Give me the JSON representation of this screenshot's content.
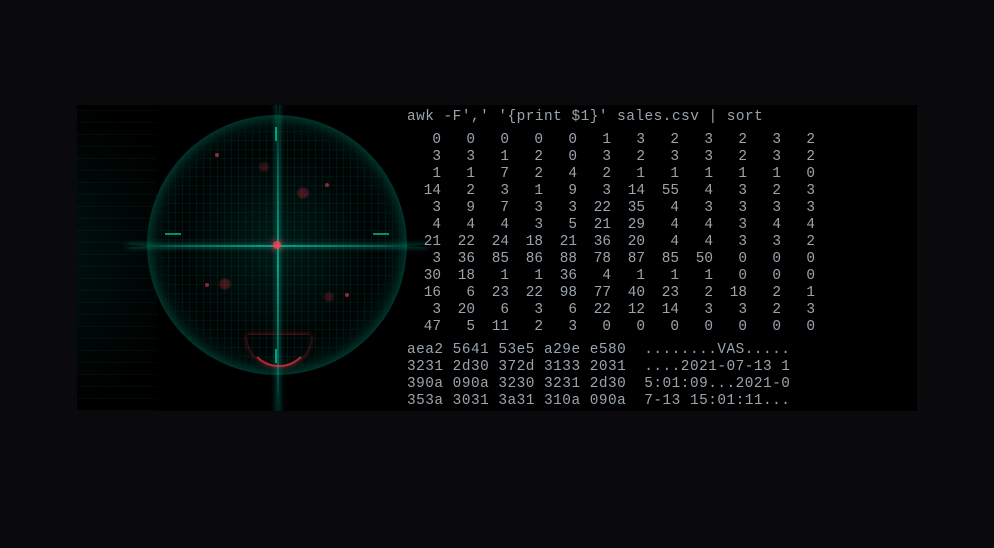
{
  "command": "awk -F',' '{print $1}' sales.csv | sort",
  "grid": [
    [
      0,
      0,
      0,
      0,
      0,
      1,
      3,
      2,
      3,
      2,
      3,
      2
    ],
    [
      3,
      3,
      1,
      2,
      0,
      3,
      2,
      3,
      3,
      2,
      3,
      2
    ],
    [
      1,
      1,
      7,
      2,
      4,
      2,
      1,
      1,
      1,
      1,
      1,
      0
    ],
    [
      14,
      2,
      3,
      1,
      9,
      3,
      14,
      55,
      4,
      3,
      2,
      3
    ],
    [
      3,
      9,
      7,
      3,
      3,
      22,
      35,
      4,
      3,
      3,
      3,
      3
    ],
    [
      4,
      4,
      4,
      3,
      5,
      21,
      29,
      4,
      4,
      3,
      4,
      4
    ],
    [
      21,
      22,
      24,
      18,
      21,
      36,
      20,
      4,
      4,
      3,
      3,
      2
    ],
    [
      3,
      36,
      85,
      86,
      88,
      78,
      87,
      85,
      50,
      0,
      0,
      0
    ],
    [
      30,
      18,
      1,
      1,
      36,
      4,
      1,
      1,
      1,
      0,
      0,
      0
    ],
    [
      16,
      6,
      23,
      22,
      98,
      77,
      40,
      23,
      2,
      18,
      2,
      1
    ],
    [
      3,
      20,
      6,
      3,
      6,
      22,
      12,
      14,
      3,
      3,
      2,
      3
    ],
    [
      47,
      5,
      11,
      2,
      3,
      0,
      0,
      0,
      0,
      0,
      0,
      0
    ]
  ],
  "hex": [
    {
      "bytes": "aea2 5641 53e5 a29e e580",
      "ascii": "........VAS....."
    },
    {
      "bytes": "3231 2d30 372d 3133 2031",
      "ascii": "....2021-07-13 1"
    },
    {
      "bytes": "390a 090a 3230 3231 2d30",
      "ascii": "5:01:09...2021-0"
    },
    {
      "bytes": "353a 3031 3a31 310a 090a",
      "ascii": "7-13 15:01:11..."
    }
  ]
}
